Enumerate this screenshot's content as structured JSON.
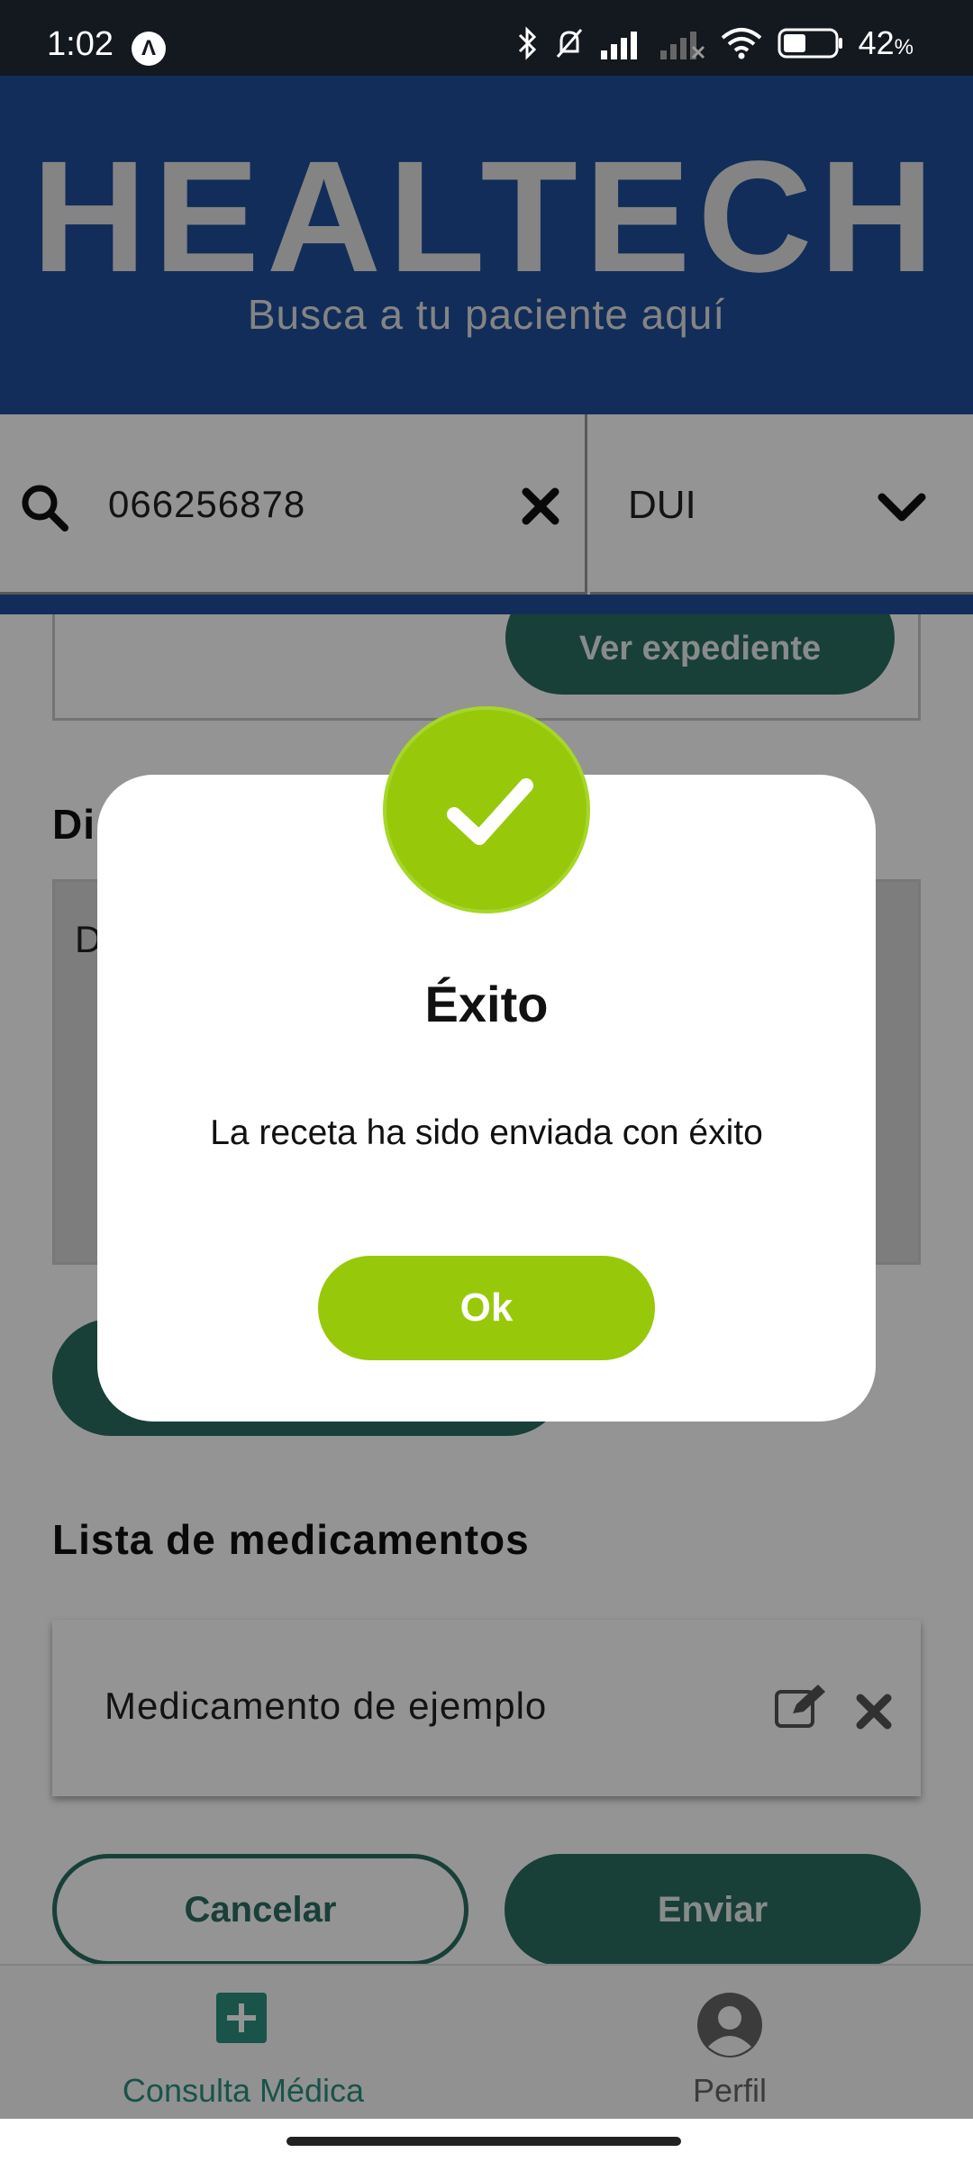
{
  "status_bar": {
    "time": "1:02",
    "app_icon_glyph": "Λ",
    "battery_percent": "42",
    "battery_unit": "%",
    "icons": [
      "bluetooth-icon",
      "bell-muted-icon",
      "signal-icon",
      "signal-weak-icon",
      "wifi-icon",
      "battery-icon"
    ]
  },
  "header": {
    "title": "HEALTECH",
    "subtitle": "Busca a tu paciente aquí"
  },
  "search": {
    "value": "066256878",
    "doc_type": "DUI"
  },
  "patient_card": {
    "ver_expediente_label": "Ver expediente"
  },
  "diagnosis": {
    "heading_visible": "Di",
    "text_visible": "D"
  },
  "medications": {
    "heading": "Lista de medicamentos",
    "items": [
      {
        "name": "Medicamento de ejemplo"
      }
    ]
  },
  "actions": {
    "cancel_label": "Cancelar",
    "send_label": "Enviar"
  },
  "bottom_nav": {
    "items": [
      {
        "label": "Consulta Médica",
        "icon": "plus-square-icon",
        "active": true
      },
      {
        "label": "Perfil",
        "icon": "user-circle-icon",
        "active": false
      }
    ]
  },
  "dialog": {
    "icon": "checkmark-icon",
    "title": "Éxito",
    "message": "La receta ha sido enviada con éxito",
    "ok_label": "Ok"
  },
  "colors": {
    "header_blue": "#1f4e99",
    "primary_green": "#2b6d62",
    "success_lime": "#97c90a"
  }
}
